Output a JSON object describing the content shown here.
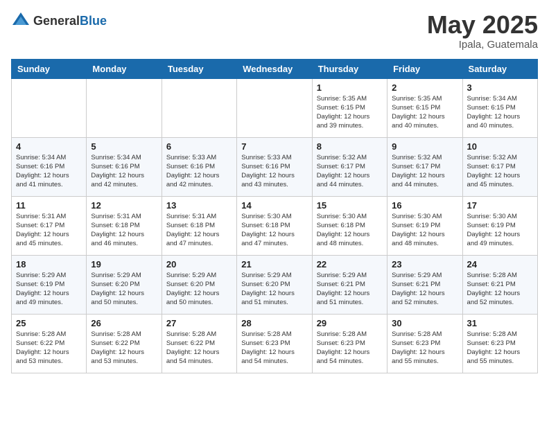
{
  "header": {
    "logo_general": "General",
    "logo_blue": "Blue",
    "month_year": "May 2025",
    "location": "Ipala, Guatemala"
  },
  "weekdays": [
    "Sunday",
    "Monday",
    "Tuesday",
    "Wednesday",
    "Thursday",
    "Friday",
    "Saturday"
  ],
  "weeks": [
    [
      {
        "day": "",
        "info": ""
      },
      {
        "day": "",
        "info": ""
      },
      {
        "day": "",
        "info": ""
      },
      {
        "day": "",
        "info": ""
      },
      {
        "day": "1",
        "info": "Sunrise: 5:35 AM\nSunset: 6:15 PM\nDaylight: 12 hours\nand 39 minutes."
      },
      {
        "day": "2",
        "info": "Sunrise: 5:35 AM\nSunset: 6:15 PM\nDaylight: 12 hours\nand 40 minutes."
      },
      {
        "day": "3",
        "info": "Sunrise: 5:34 AM\nSunset: 6:15 PM\nDaylight: 12 hours\nand 40 minutes."
      }
    ],
    [
      {
        "day": "4",
        "info": "Sunrise: 5:34 AM\nSunset: 6:16 PM\nDaylight: 12 hours\nand 41 minutes."
      },
      {
        "day": "5",
        "info": "Sunrise: 5:34 AM\nSunset: 6:16 PM\nDaylight: 12 hours\nand 42 minutes."
      },
      {
        "day": "6",
        "info": "Sunrise: 5:33 AM\nSunset: 6:16 PM\nDaylight: 12 hours\nand 42 minutes."
      },
      {
        "day": "7",
        "info": "Sunrise: 5:33 AM\nSunset: 6:16 PM\nDaylight: 12 hours\nand 43 minutes."
      },
      {
        "day": "8",
        "info": "Sunrise: 5:32 AM\nSunset: 6:17 PM\nDaylight: 12 hours\nand 44 minutes."
      },
      {
        "day": "9",
        "info": "Sunrise: 5:32 AM\nSunset: 6:17 PM\nDaylight: 12 hours\nand 44 minutes."
      },
      {
        "day": "10",
        "info": "Sunrise: 5:32 AM\nSunset: 6:17 PM\nDaylight: 12 hours\nand 45 minutes."
      }
    ],
    [
      {
        "day": "11",
        "info": "Sunrise: 5:31 AM\nSunset: 6:17 PM\nDaylight: 12 hours\nand 45 minutes."
      },
      {
        "day": "12",
        "info": "Sunrise: 5:31 AM\nSunset: 6:18 PM\nDaylight: 12 hours\nand 46 minutes."
      },
      {
        "day": "13",
        "info": "Sunrise: 5:31 AM\nSunset: 6:18 PM\nDaylight: 12 hours\nand 47 minutes."
      },
      {
        "day": "14",
        "info": "Sunrise: 5:30 AM\nSunset: 6:18 PM\nDaylight: 12 hours\nand 47 minutes."
      },
      {
        "day": "15",
        "info": "Sunrise: 5:30 AM\nSunset: 6:18 PM\nDaylight: 12 hours\nand 48 minutes."
      },
      {
        "day": "16",
        "info": "Sunrise: 5:30 AM\nSunset: 6:19 PM\nDaylight: 12 hours\nand 48 minutes."
      },
      {
        "day": "17",
        "info": "Sunrise: 5:30 AM\nSunset: 6:19 PM\nDaylight: 12 hours\nand 49 minutes."
      }
    ],
    [
      {
        "day": "18",
        "info": "Sunrise: 5:29 AM\nSunset: 6:19 PM\nDaylight: 12 hours\nand 49 minutes."
      },
      {
        "day": "19",
        "info": "Sunrise: 5:29 AM\nSunset: 6:20 PM\nDaylight: 12 hours\nand 50 minutes."
      },
      {
        "day": "20",
        "info": "Sunrise: 5:29 AM\nSunset: 6:20 PM\nDaylight: 12 hours\nand 50 minutes."
      },
      {
        "day": "21",
        "info": "Sunrise: 5:29 AM\nSunset: 6:20 PM\nDaylight: 12 hours\nand 51 minutes."
      },
      {
        "day": "22",
        "info": "Sunrise: 5:29 AM\nSunset: 6:21 PM\nDaylight: 12 hours\nand 51 minutes."
      },
      {
        "day": "23",
        "info": "Sunrise: 5:29 AM\nSunset: 6:21 PM\nDaylight: 12 hours\nand 52 minutes."
      },
      {
        "day": "24",
        "info": "Sunrise: 5:28 AM\nSunset: 6:21 PM\nDaylight: 12 hours\nand 52 minutes."
      }
    ],
    [
      {
        "day": "25",
        "info": "Sunrise: 5:28 AM\nSunset: 6:22 PM\nDaylight: 12 hours\nand 53 minutes."
      },
      {
        "day": "26",
        "info": "Sunrise: 5:28 AM\nSunset: 6:22 PM\nDaylight: 12 hours\nand 53 minutes."
      },
      {
        "day": "27",
        "info": "Sunrise: 5:28 AM\nSunset: 6:22 PM\nDaylight: 12 hours\nand 54 minutes."
      },
      {
        "day": "28",
        "info": "Sunrise: 5:28 AM\nSunset: 6:23 PM\nDaylight: 12 hours\nand 54 minutes."
      },
      {
        "day": "29",
        "info": "Sunrise: 5:28 AM\nSunset: 6:23 PM\nDaylight: 12 hours\nand 54 minutes."
      },
      {
        "day": "30",
        "info": "Sunrise: 5:28 AM\nSunset: 6:23 PM\nDaylight: 12 hours\nand 55 minutes."
      },
      {
        "day": "31",
        "info": "Sunrise: 5:28 AM\nSunset: 6:23 PM\nDaylight: 12 hours\nand 55 minutes."
      }
    ]
  ]
}
